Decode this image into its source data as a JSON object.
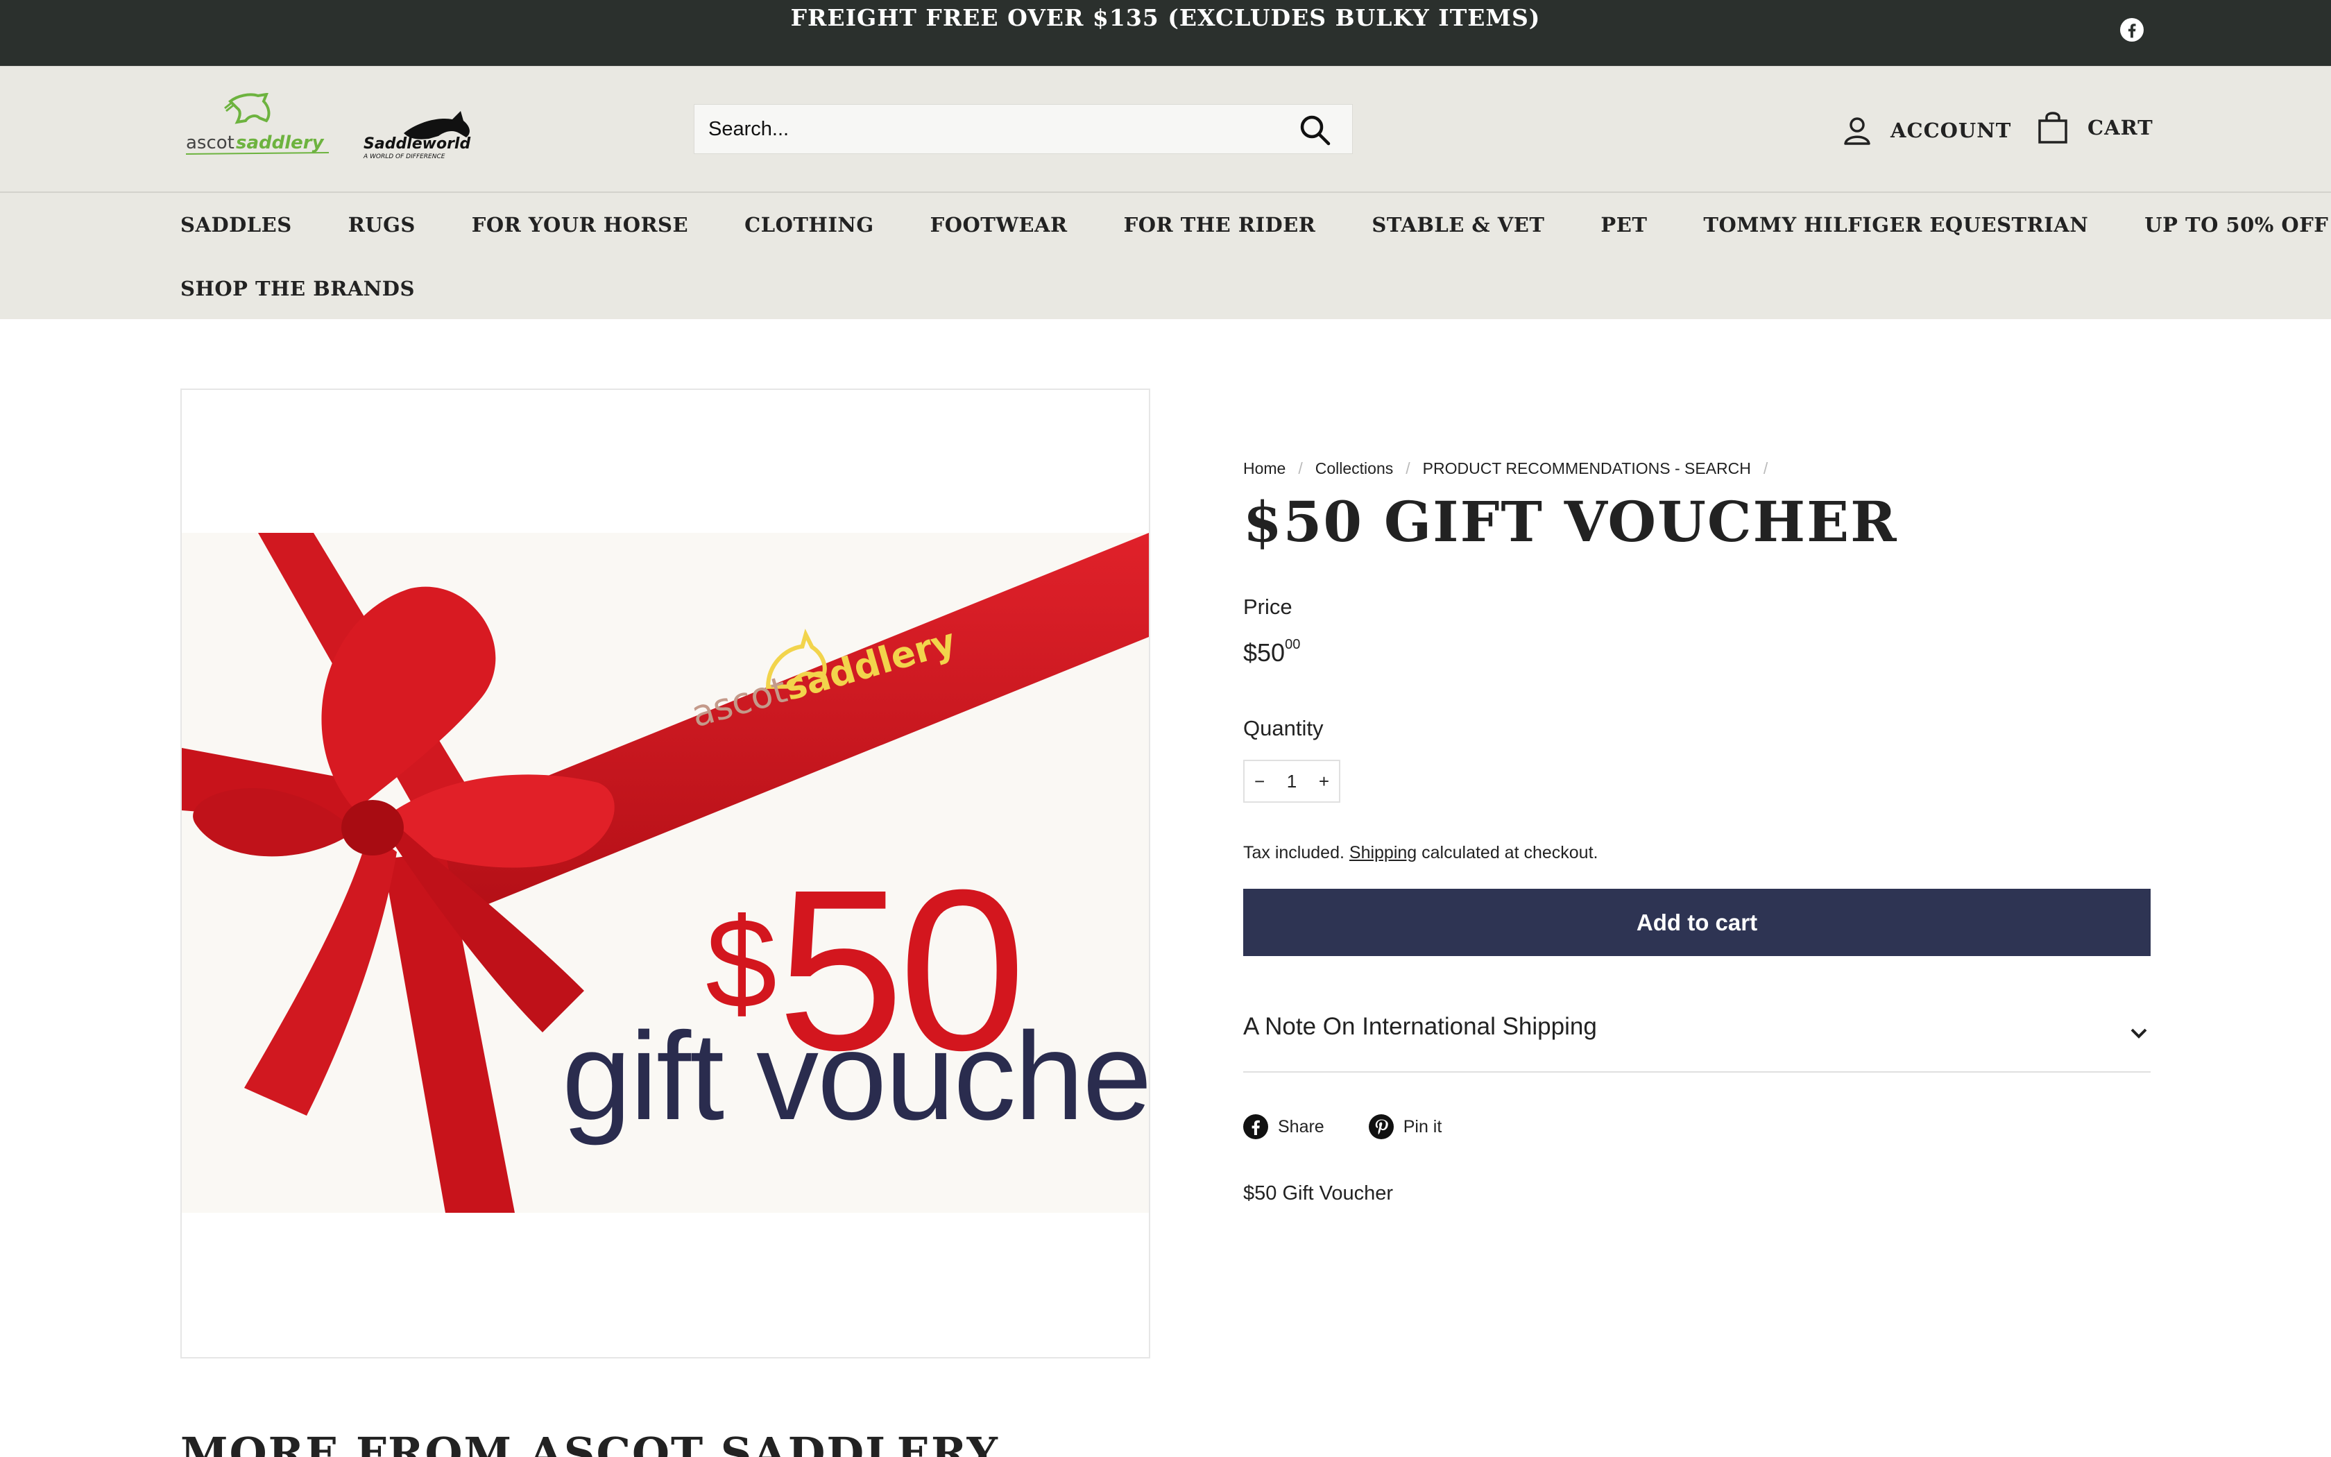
{
  "announcement": {
    "text": "FREIGHT FREE OVER $135 (EXCLUDES BULKY ITEMS)",
    "social_icon": "facebook-icon"
  },
  "header": {
    "logos": [
      {
        "name": "ascot-saddlery-logo",
        "text_a": "ascot",
        "text_b": "saddlery"
      },
      {
        "name": "saddleworld-logo",
        "text": "Saddleworld",
        "tagline": "A WORLD OF DIFFERENCE"
      }
    ],
    "search": {
      "placeholder": "Search...",
      "icon": "search-icon"
    },
    "account_label": "ACCOUNT",
    "cart_label": "CART"
  },
  "nav": {
    "items": [
      "SADDLES",
      "RUGS",
      "FOR YOUR HORSE",
      "CLOTHING",
      "FOOTWEAR",
      "FOR THE RIDER",
      "STABLE & VET",
      "PET",
      "TOMMY HILFIGER EQUESTRIAN",
      "UP TO 50% OFF"
    ],
    "items_row2": [
      "SHOP THE BRANDS"
    ]
  },
  "product_image": {
    "brand_a": "ascot",
    "brand_b": "saddlery",
    "dollar": "$",
    "amount": "50",
    "caption": "gift voucher"
  },
  "breadcrumb": [
    "Home",
    "Collections",
    "PRODUCT RECOMMENDATIONS - SEARCH"
  ],
  "product": {
    "title": "$50 GIFT VOUCHER",
    "price_label": "Price",
    "price_main": "$50",
    "price_cents": "00",
    "quantity_label": "Quantity",
    "quantity_minus": "−",
    "quantity_value": "1",
    "quantity_plus": "+",
    "tax_prefix": "Tax included.",
    "tax_link": "Shipping",
    "tax_suffix": "calculated at checkout.",
    "add_to_cart": "Add to cart",
    "accordion_title": "A Note On International Shipping",
    "share_label": "Share",
    "pin_label": "Pin it",
    "description": "$50 Gift Voucher"
  },
  "more_heading": "MORE FROM ASCOT SADDLERY",
  "colors": {
    "announce_bg": "#2b302d",
    "header_bg": "#e9e8e2",
    "button_bg": "#2e3453",
    "ribbon": "#d3161e",
    "logo_green": "#6db33f"
  }
}
